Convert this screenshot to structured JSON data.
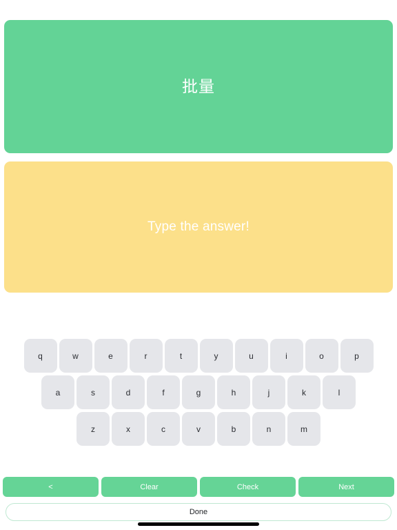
{
  "prompt": {
    "text": "批量",
    "background_color": "#63d396",
    "text_color": "#ffffff"
  },
  "answer": {
    "value": "",
    "placeholder": "Type the answer!",
    "background_color": "#fce08a",
    "text_color": "#ffffff"
  },
  "keyboard": {
    "rows": [
      {
        "keys": [
          "q",
          "w",
          "e",
          "r",
          "t",
          "y",
          "u",
          "i",
          "o",
          "p"
        ]
      },
      {
        "keys": [
          "a",
          "s",
          "d",
          "f",
          "g",
          "h",
          "j",
          "k",
          "l"
        ]
      },
      {
        "keys": [
          "z",
          "x",
          "c",
          "v",
          "b",
          "n",
          "m"
        ]
      }
    ],
    "key_background_color": "#e5e6ea",
    "key_text_color": "#2b2d32"
  },
  "actions": {
    "back_label": "<",
    "clear_label": "Clear",
    "check_label": "Check",
    "next_label": "Next",
    "button_color": "#65d496",
    "button_text_color": "#ffffff"
  },
  "done": {
    "label": "Done",
    "border_color": "#bfe8d2",
    "text_color": "#232529"
  }
}
